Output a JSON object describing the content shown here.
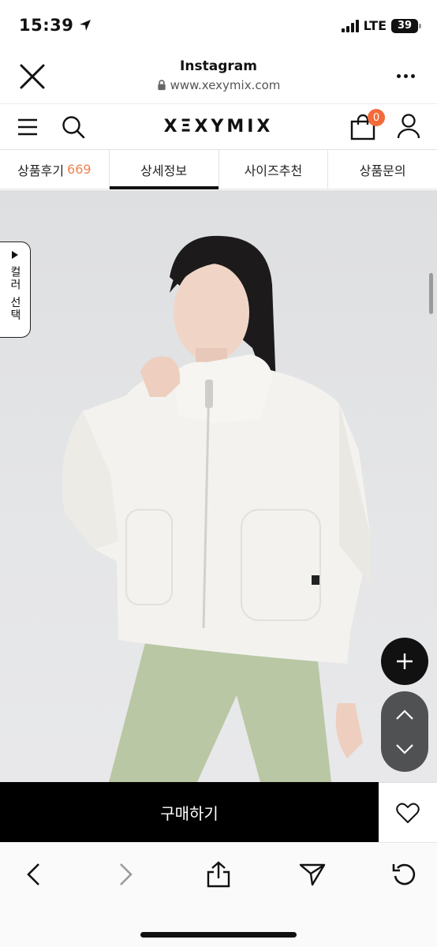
{
  "status_bar": {
    "time": "15:39",
    "network": "LTE",
    "battery": "39"
  },
  "browser_header": {
    "title": "Instagram",
    "url": "www.xexymix.com",
    "icons": [
      "close-icon",
      "lock-icon",
      "more-icon"
    ]
  },
  "site_nav": {
    "brand": "XΞXYMIX",
    "cart_count": "0",
    "icons": [
      "menu-icon",
      "search-icon",
      "shopping-bag-icon",
      "user-icon"
    ]
  },
  "tabs": [
    {
      "label": "상품후기",
      "count": "669"
    },
    {
      "label": "상세정보",
      "count": ""
    },
    {
      "label": "사이즈추천",
      "count": ""
    },
    {
      "label": "상품문의",
      "count": ""
    }
  ],
  "active_tab": "상세정보",
  "product": {
    "color_select_label": "컬러 선택"
  },
  "buy_bar": {
    "buy_label": "구매하기"
  },
  "colors": {
    "accent": "#f26b3a",
    "review_count": "#f0824f",
    "buy_bg": "#000000",
    "fab_bg": "#505152"
  },
  "toolbar": {
    "icons": [
      "back-icon",
      "forward-icon",
      "share-icon",
      "send-icon",
      "reload-icon"
    ]
  }
}
